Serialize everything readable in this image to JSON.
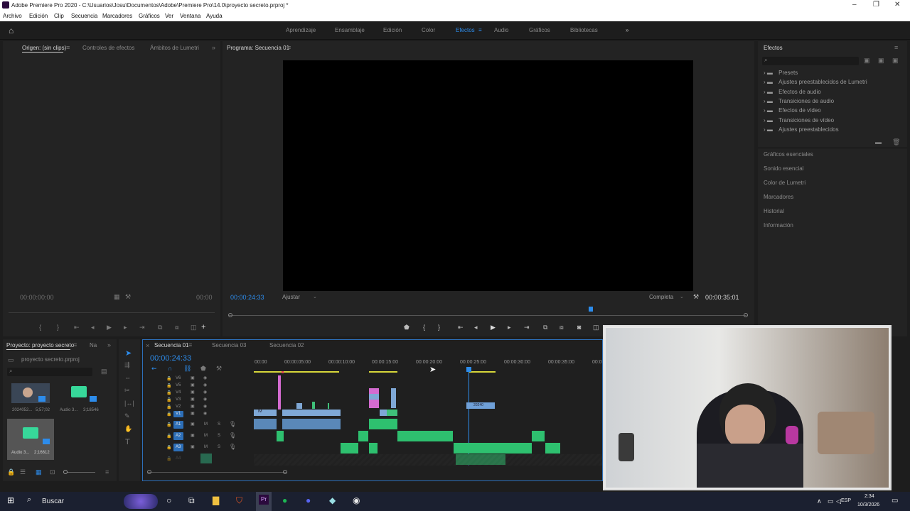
{
  "window": {
    "title": "Adobe Premiere Pro 2020 - C:\\Usuarios\\Josu\\Documentos\\Adobe\\Premiere Pro\\14.0\\proyecto secreto.prproj *"
  },
  "menu": [
    "Archivo",
    "Edición",
    "Clip",
    "Secuencia",
    "Marcadores",
    "Gráficos",
    "Ver",
    "Ventana",
    "Ayuda"
  ],
  "workspaces": {
    "items": [
      "Aprendizaje",
      "Ensamblaje",
      "Edición",
      "Color",
      "Efectos",
      "Audio",
      "Gráficos",
      "Bibliotecas"
    ],
    "active": "Efectos",
    "more": "»"
  },
  "source_panel": {
    "tabs": [
      "Origen: (sin clips)",
      "Controles de efectos",
      "Ámbitos de Lumetri"
    ],
    "more": "»",
    "timecode_left": "00:00:00:00",
    "timecode_right": "00:00"
  },
  "program_panel": {
    "tab": "Programa: Secuencia 01",
    "timecode": "00:00:24:33",
    "fit": "Ajustar",
    "quality": "Completa",
    "duration": "00:00:35:01"
  },
  "effects_panel": {
    "title": "Efectos",
    "folders": [
      "Presets",
      "Ajustes preestablecidos de Lumetri",
      "Efectos de audio",
      "Transiciones de audio",
      "Efectos de vídeo",
      "Transiciones de vídeo",
      "Ajustes preestablecidos"
    ],
    "groups": [
      "Gráficos esenciales",
      "Sonido esencial",
      "Color de Lumetri",
      "Marcadores",
      "Historial",
      "Información"
    ]
  },
  "project_panel": {
    "tab": "Proyecto: proyecto secreto",
    "tab2": "Na",
    "more": "»",
    "file": "proyecto secreto.prproj",
    "items": [
      {
        "name": "2024052...",
        "duration": "5;57;02"
      },
      {
        "name": "Audio 3...",
        "duration": "3;18546"
      },
      {
        "name": "Audio 3...",
        "duration": "2;16612"
      }
    ]
  },
  "timeline": {
    "tabs": [
      "Secuencia 01",
      "Secuencia 03",
      "Secuencia 02"
    ],
    "timecode": "00:00:24:33",
    "ruler": [
      "00:00",
      "00:00:05:00",
      "00:00:10:00",
      "00:00:15:00",
      "00:00:20:00",
      "00:00:25:00",
      "00:00:30:00",
      "00:00:35:00",
      "00:0"
    ],
    "video_tracks": [
      "V6",
      "V5",
      "V4",
      "V3",
      "V2",
      "V1"
    ],
    "audio_tracks": [
      "A1",
      "A2",
      "A3",
      "A4"
    ],
    "mute": "M",
    "solo": "S",
    "clip_label": "20240",
    "v1_label": "IM"
  },
  "taskbar": {
    "search": "Buscar",
    "lang": "ESP",
    "time": "2:34",
    "date": "10/3/2026"
  }
}
